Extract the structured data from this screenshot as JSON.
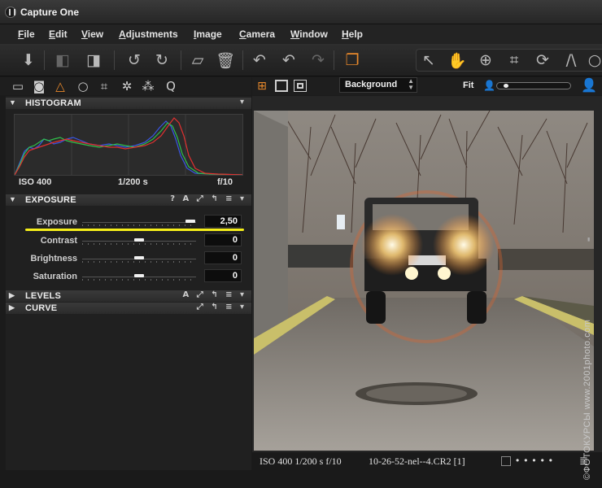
{
  "window": {
    "title": "Capture One"
  },
  "menu": [
    "File",
    "Edit",
    "View",
    "Adjustments",
    "Image",
    "Camera",
    "Window",
    "Help"
  ],
  "toolbar": {
    "icons": [
      "import-icon",
      "previous-icon",
      "next-icon",
      "rotate-left-icon",
      "rotate-right-icon",
      "move-to-folder-icon",
      "trash-icon",
      "undo-icon",
      "undo-step-icon",
      "redo-icon",
      "compare-icon",
      "cursor-icon",
      "hand-icon",
      "zoom-icon",
      "crop-icon",
      "rotate-tool-icon",
      "keystone-icon",
      "spot-icon"
    ]
  },
  "tool_tabs": [
    "library-icon",
    "capture-icon",
    "color-icon",
    "focus-icon",
    "crop-tab-icon",
    "adjustments-icon",
    "metadata-icon",
    "quick-icon"
  ],
  "histogram": {
    "header": "HISTOGRAM",
    "iso": "ISO 400",
    "shutter": "1/200 s",
    "aperture": "f/10"
  },
  "exposure": {
    "header": "EXPOSURE",
    "header_icons": "? A ⤢ ↰ ≡ ▾",
    "sliders": [
      {
        "label": "Exposure",
        "value": "2,50",
        "position": 0.95
      },
      {
        "label": "Contrast",
        "value": "0",
        "position": 0.5
      },
      {
        "label": "Brightness",
        "value": "0",
        "position": 0.5
      },
      {
        "label": "Saturation",
        "value": "0",
        "position": 0.5
      }
    ]
  },
  "levels": {
    "header": "LEVELS",
    "header_icons": "A ⤢ ↰ ≡ ▾"
  },
  "curve": {
    "header": "CURVE",
    "header_icons": "⤢ ↰ ≡ ▾"
  },
  "viewer": {
    "background_label": "Background",
    "zoom_label": "Fit",
    "zoom_level": 0.1
  },
  "status": {
    "exif": "ISO 400  1/200 s  f/10",
    "filename": "10-26-52-nel--4.CR2 [1]"
  },
  "watermark": "©ФОТОКУРСЫ www.2001photo.com",
  "colors": {
    "accent": "#e8892b",
    "highlight": "#f5ee1a",
    "panel": "#202020"
  }
}
